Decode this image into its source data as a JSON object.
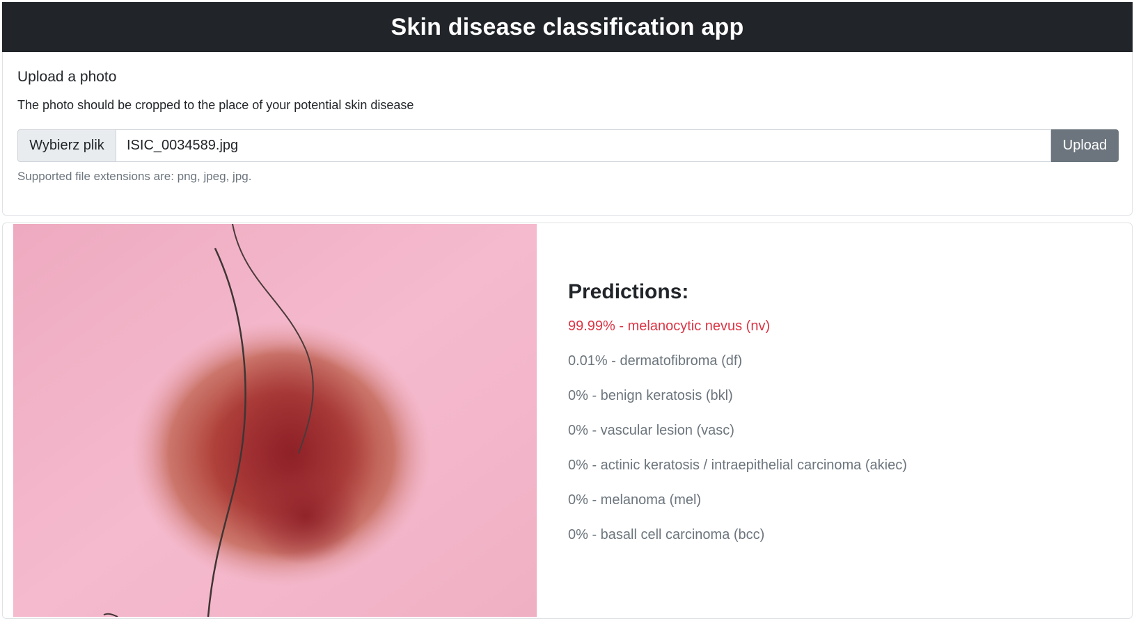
{
  "navbar": {
    "title": "Skin disease classification app"
  },
  "upload": {
    "title": "Upload a photo",
    "description": "The photo should be cropped to the place of your potential skin disease",
    "choose_label": "Wybierz plik",
    "file_name": "ISIC_0034589.jpg",
    "button_label": "Upload",
    "help_text": "Supported file extensions are: png, jpeg, jpg."
  },
  "results": {
    "heading": "Predictions:",
    "items": [
      "99.99% - melanocytic nevus (nv)",
      "0.01% - dermatofibroma (df)",
      "0% - benign keratosis (bkl)",
      "0% - vascular lesion (vasc)",
      "0% - actinic keratosis / intraepithelial carcinoma (akiec)",
      "0% - melanoma (mel)",
      "0% - basall cell carcinoma (bcc)"
    ]
  },
  "colors": {
    "navbar_bg": "#212529",
    "top_prediction": "#dc3545",
    "muted": "#6c757d",
    "skin_bg": "#f2b3c6",
    "lesion": "#a8322e"
  }
}
